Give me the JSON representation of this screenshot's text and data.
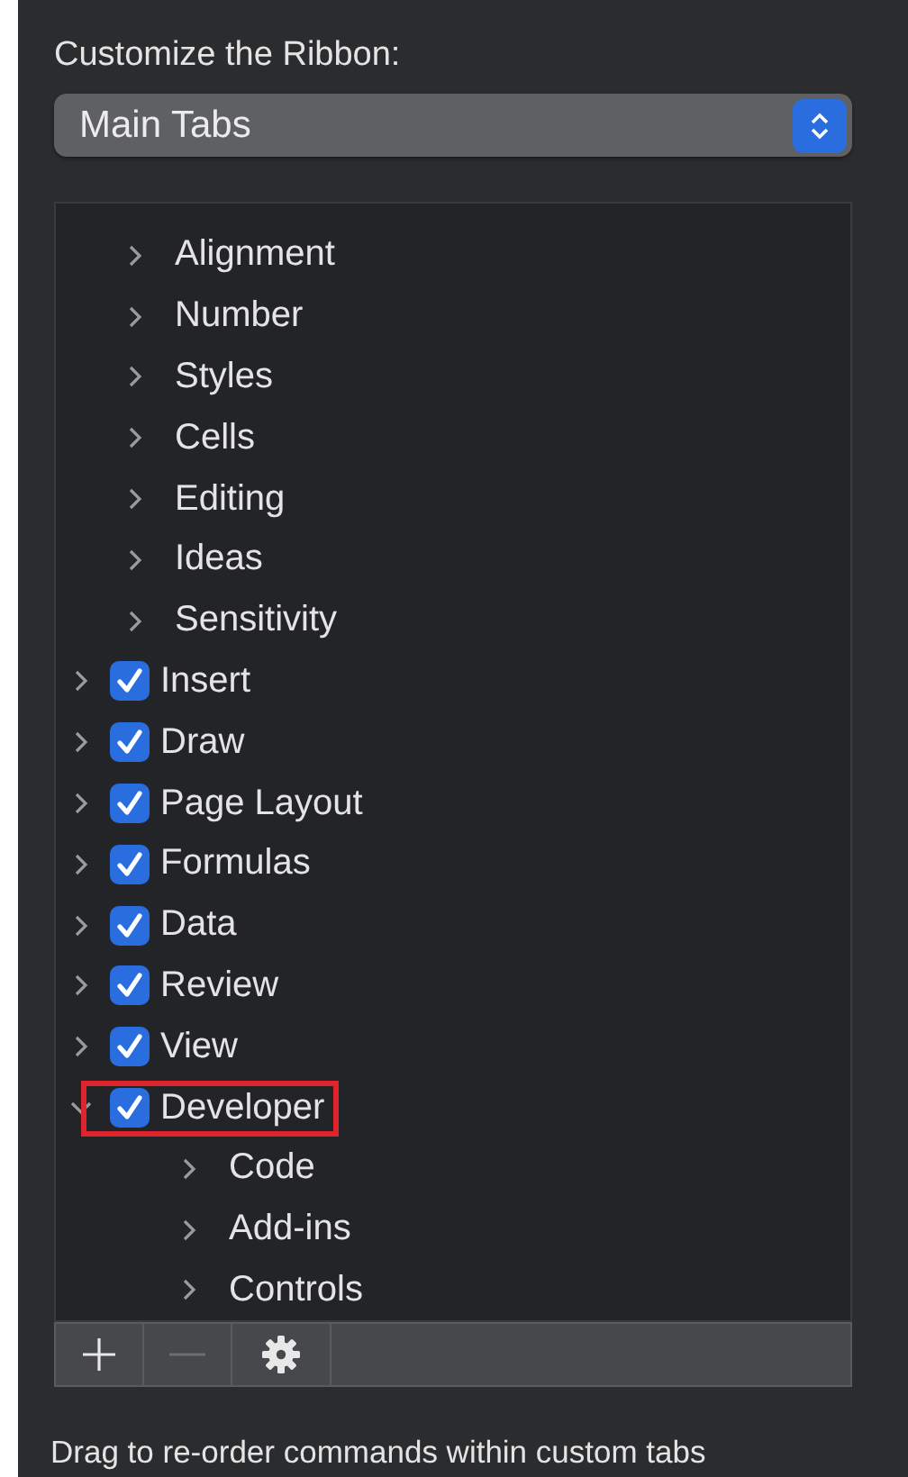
{
  "heading": "Customize the Ribbon:",
  "dropdown": {
    "value": "Main Tabs"
  },
  "tree": {
    "items": [
      {
        "kind": "group",
        "label": "Alignment",
        "expanded": false
      },
      {
        "kind": "group",
        "label": "Number",
        "expanded": false
      },
      {
        "kind": "group",
        "label": "Styles",
        "expanded": false
      },
      {
        "kind": "group",
        "label": "Cells",
        "expanded": false
      },
      {
        "kind": "group",
        "label": "Editing",
        "expanded": false
      },
      {
        "kind": "group",
        "label": "Ideas",
        "expanded": false
      },
      {
        "kind": "group",
        "label": "Sensitivity",
        "expanded": false
      },
      {
        "kind": "tab",
        "label": "Insert",
        "checked": true,
        "expanded": false,
        "highlighted": false
      },
      {
        "kind": "tab",
        "label": "Draw",
        "checked": true,
        "expanded": false,
        "highlighted": false
      },
      {
        "kind": "tab",
        "label": "Page Layout",
        "checked": true,
        "expanded": false,
        "highlighted": false
      },
      {
        "kind": "tab",
        "label": "Formulas",
        "checked": true,
        "expanded": false,
        "highlighted": false
      },
      {
        "kind": "tab",
        "label": "Data",
        "checked": true,
        "expanded": false,
        "highlighted": false
      },
      {
        "kind": "tab",
        "label": "Review",
        "checked": true,
        "expanded": false,
        "highlighted": false
      },
      {
        "kind": "tab",
        "label": "View",
        "checked": true,
        "expanded": false,
        "highlighted": false
      },
      {
        "kind": "tab",
        "label": "Developer",
        "checked": true,
        "expanded": true,
        "highlighted": true,
        "children": [
          {
            "kind": "group",
            "label": "Code",
            "expanded": false
          },
          {
            "kind": "group",
            "label": "Add-ins",
            "expanded": false
          },
          {
            "kind": "group",
            "label": "Controls",
            "expanded": false
          }
        ]
      }
    ]
  },
  "toolbar": {
    "buttons": [
      {
        "kind": "add",
        "disabled": false
      },
      {
        "kind": "remove",
        "disabled": true
      },
      {
        "kind": "settings",
        "disabled": false
      }
    ]
  },
  "footer": "Drag to re-order commands within custom tabs"
}
